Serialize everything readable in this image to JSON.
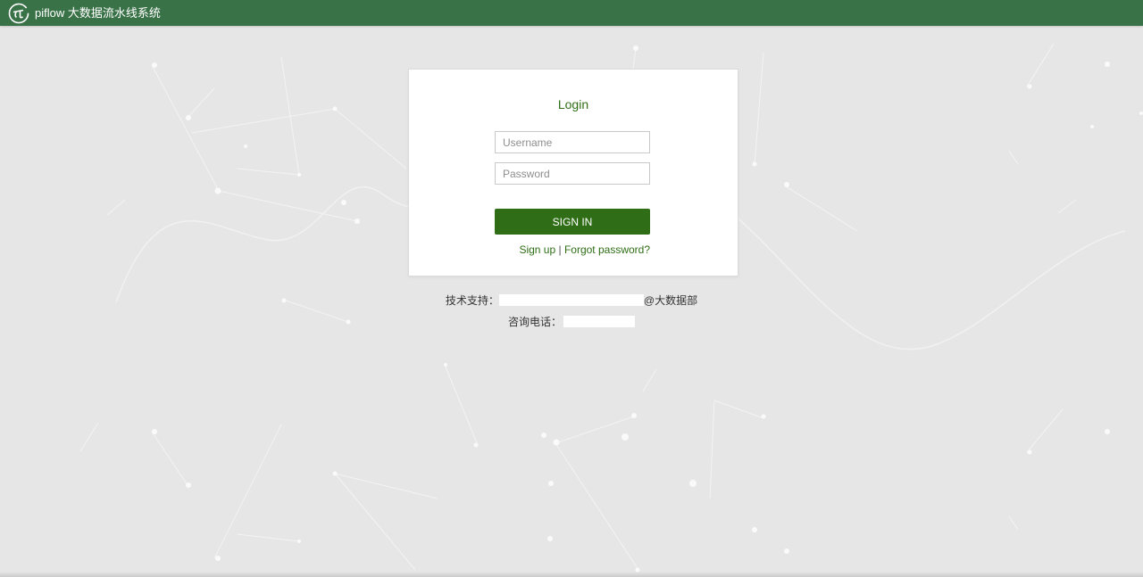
{
  "app": {
    "title": "piflow 大数据流水线系统",
    "logo_icon": "piflow-logo-icon",
    "header_color": "#3a7248"
  },
  "login": {
    "title": "Login",
    "username_placeholder": "Username",
    "password_placeholder": "Password",
    "signin_label": "SIGN IN",
    "signup_label": "Sign up",
    "separator": "|",
    "forgot_label": "Forgot password?",
    "accent_color": "#2f6e16"
  },
  "footer": {
    "support_label": "技术支持：",
    "support_suffix": "@大数据部",
    "phone_label": "咨询电话："
  }
}
